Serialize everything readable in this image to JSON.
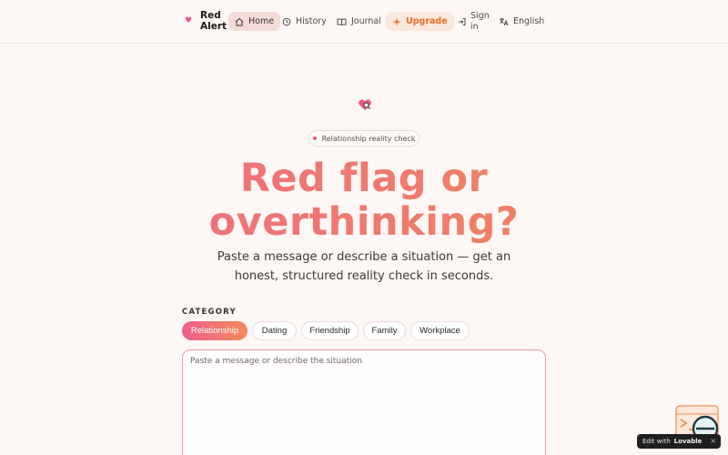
{
  "nav": {
    "brand": "Red Alert",
    "home": "Home",
    "history": "History",
    "journal": "Journal",
    "upgrade": "Upgrade",
    "signin": "Sign in",
    "language": "English"
  },
  "hero": {
    "badge": "Relationship reality check",
    "headline_line1": "Red flag or",
    "headline_line2": "overthinking?",
    "subtitle": "Paste a message or describe a situation — get an honest, structured reality check in seconds."
  },
  "category": {
    "label": "CATEGORY",
    "options": [
      "Relationship",
      "Dating",
      "Friendship",
      "Family",
      "Workplace"
    ],
    "selected": "Relationship"
  },
  "input": {
    "placeholder": "Paste a message or describe the situation",
    "value": ""
  },
  "edit_badge": {
    "text": "Edit with",
    "brand": "Lovable",
    "close": "×"
  },
  "colors": {
    "accent_pink": "#ee5f8b",
    "accent_orange": "#f28b5c",
    "upgrade_orange": "#ec6e24",
    "background": "#fdf7f5"
  }
}
